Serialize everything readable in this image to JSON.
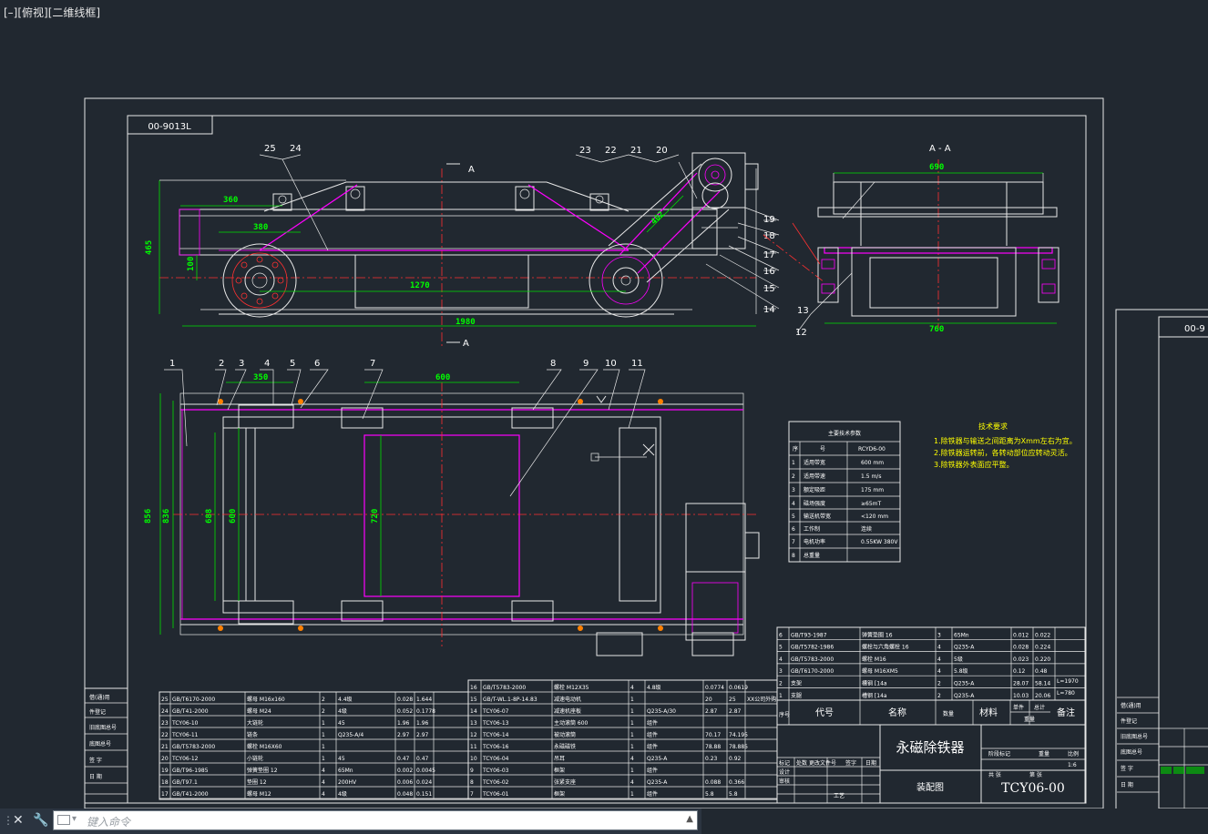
{
  "viewport": {
    "label": "[–][俯视][二维线框]"
  },
  "sheet": {
    "code": "00-9013L",
    "right_code": "00-9"
  },
  "dims": {
    "d360": "360",
    "d465": "465",
    "d380": "380",
    "d100": "100",
    "d1270": "1270",
    "d1980": "1980",
    "d402": "402",
    "d690": "690",
    "d760": "760",
    "d350": "350",
    "d600": "600",
    "d856": "856",
    "d836": "836",
    "d688": "688",
    "d600v": "600",
    "d720": "720"
  },
  "sections": {
    "aa_title": "A - A",
    "mark_a": "A"
  },
  "balloons": [
    "1",
    "2",
    "3",
    "4",
    "5",
    "6",
    "7",
    "8",
    "9",
    "10",
    "11",
    "12",
    "13",
    "14",
    "15",
    "16",
    "17",
    "18",
    "19",
    "20",
    "21",
    "22",
    "23",
    "24",
    "25"
  ],
  "tech": {
    "title": "技术要求",
    "notes": [
      "1.除铁器与输送之间距离为Xmm左右为宜。",
      "2.除铁器运转前，各转动部位应转动灵活。",
      "3.除铁器外表面应平整。"
    ]
  },
  "params_table": {
    "title": "主要技术参数",
    "header": [
      "序",
      "号",
      "RCYD6-00"
    ],
    "rows": [
      [
        "1",
        "适用带宽",
        "600 mm"
      ],
      [
        "2",
        "适用带速",
        "1.5 m/s"
      ],
      [
        "3",
        "额定吸距",
        "175 mm"
      ],
      [
        "4",
        "磁场强度",
        "≥65mT"
      ],
      [
        "5",
        "输送机带宽",
        "<120 mm"
      ],
      [
        "6",
        "工作制",
        "连续"
      ],
      [
        "7",
        "电机功率",
        "0.55KW 380V"
      ],
      [
        "8",
        "总重量",
        ""
      ]
    ]
  },
  "bom_left": [
    [
      "25",
      "GB/T6170-2000",
      "螺母 M16x160",
      "2",
      "4.4级",
      "0.028",
      "1.644",
      ""
    ],
    [
      "24",
      "GB/T41-2000",
      "螺母 M24",
      "2",
      "4级",
      "0.052",
      "0.1778",
      ""
    ],
    [
      "23",
      "TCY06-10",
      "大链轮",
      "1",
      "45",
      "1.96",
      "1.96",
      ""
    ],
    [
      "22",
      "TCY06-11",
      "链条",
      "1",
      "Q235-A/4",
      "2.97",
      "2.97",
      ""
    ],
    [
      "21",
      "GB/T5783-2000",
      "螺栓 M16X60",
      "1",
      "",
      "",
      "",
      ""
    ],
    [
      "20",
      "TCY06-12",
      "小链轮",
      "1",
      "45",
      "0.47",
      "0.47",
      ""
    ],
    [
      "19",
      "GB/T96-1985",
      "弹簧垫圈 12",
      "4",
      "65Mn",
      "0.002",
      "0.0045",
      ""
    ],
    [
      "18",
      "GB/T97.1",
      "垫圈 12",
      "4",
      "200HV",
      "0.006",
      "0.024",
      ""
    ],
    [
      "17",
      "GB/T41-2000",
      "螺母 M12",
      "4",
      "4级",
      "0.048",
      "0.151",
      ""
    ]
  ],
  "bom_mid": [
    [
      "16",
      "GB/T5783-2000",
      "螺栓 M12X35",
      "4",
      "4.8级",
      "0.0774",
      "0.0619",
      ""
    ],
    [
      "15",
      "GB/T-WL.1-8P-14.83",
      "减速电动机",
      "1",
      "",
      "20",
      "25",
      "XX公司外购"
    ],
    [
      "14",
      "TCY06-07",
      "减速机座板",
      "1",
      "Q235-A/30",
      "2.87",
      "2.87",
      ""
    ],
    [
      "13",
      "TCY06-13",
      "主动滚筒 600",
      "1",
      "组件",
      "",
      "",
      ""
    ],
    [
      "12",
      "TCY06-14",
      "被动滚筒",
      "1",
      "组件",
      "70.17",
      "74.195",
      ""
    ],
    [
      "11",
      "TCY06-16",
      "永磁磁铁",
      "1",
      "组件",
      "78.88",
      "78.885",
      ""
    ],
    [
      "10",
      "TCY06-04",
      "吊耳",
      "4",
      "Q235-A",
      "0.23",
      "0.92",
      ""
    ],
    [
      "9",
      "TCY06-03",
      "框架",
      "1",
      "组件",
      "",
      "",
      ""
    ],
    [
      "8",
      "TCY06-02",
      "张紧支座",
      "4",
      "Q235-A",
      "0.088",
      "0.366",
      ""
    ],
    [
      "7",
      "TCY06-01",
      "框架",
      "1",
      "组件",
      "5.8",
      "5.8",
      ""
    ]
  ],
  "bom_right": [
    [
      "6",
      "GB/T93-1987",
      "弹簧垫圈 16",
      "3",
      "65Mn",
      "0.012",
      "0.022"
    ],
    [
      "5",
      "GB/T5782-1986",
      "螺栓与六角螺栓 16",
      "4",
      "Q235-A",
      "0.028",
      "0.224"
    ],
    [
      "4",
      "GB/T5783-2000",
      "螺栓 M16",
      "4",
      "5级",
      "0.023",
      "0.220"
    ],
    [
      "3",
      "GB/T6170-2000",
      "螺母 M16XM5",
      "4",
      "5.8级",
      "0.12",
      "0.48"
    ],
    [
      "2",
      "支架",
      "槽钢 [14a",
      "2",
      "Q235-A",
      "28.07",
      "58.14"
    ],
    [
      "1",
      "支腿",
      "槽钢 [14a",
      "2",
      "Q235-A",
      "10.03",
      "20.06"
    ]
  ],
  "bom_right_extra": [
    "L=1970",
    "L=780"
  ],
  "bom_header": {
    "seq": "序号",
    "code": "代号",
    "name": "名称",
    "qty": "数量",
    "material": "材料",
    "unit_w": "单件",
    "total_w": "总计",
    "weight": "重量",
    "note": "备注"
  },
  "title_block": {
    "name": "永磁除铁器",
    "drawing_type": "装配图",
    "number": "TCY06-00",
    "scale": "1:6",
    "stage_labels": [
      "阶段标记",
      "重量",
      "比例"
    ],
    "rows_left": [
      "标记",
      "处数",
      "更改文件号",
      "签字",
      "日期",
      "设计",
      "审核",
      "工艺"
    ],
    "sheet": [
      "共 张",
      "第 张"
    ],
    "approve": "批准"
  },
  "side_labels": {
    "left": [
      "借(通)用",
      "件登记",
      "旧底图总号",
      "底图总号",
      "签 字",
      "日 期"
    ],
    "right": [
      "借(通)用",
      "件登记",
      "旧底图总号",
      "底图总号",
      "签 字",
      "日 期"
    ]
  },
  "cmd": {
    "placeholder": "键入命令",
    "grip": "⋮",
    "close": "✕",
    "tool": "🔧"
  }
}
